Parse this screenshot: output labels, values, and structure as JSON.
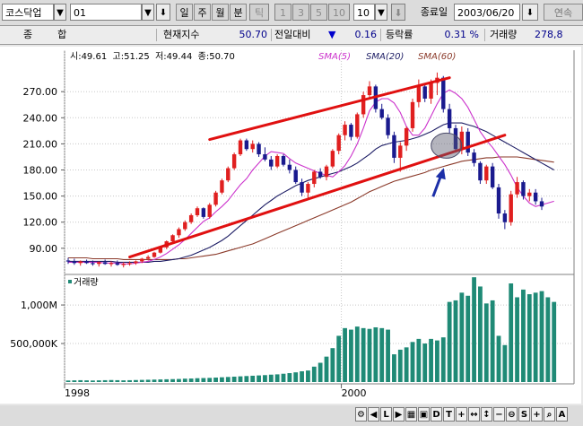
{
  "toolbar": {
    "market": "코스닥업",
    "code": "01",
    "period_buttons": [
      "일",
      "주",
      "월",
      "분",
      "틱"
    ],
    "interval_buttons": [
      "1",
      "3",
      "5",
      "10"
    ],
    "interval_value": "10",
    "end_date_label": "종료일",
    "end_date": "2003/06/20",
    "continuous_label": "연속"
  },
  "infobar": {
    "name": "종        합",
    "current_label": "현재지수",
    "current_value": "50.70",
    "change_label": "전일대비",
    "change_symbol": "▼",
    "change_value": "0.16",
    "rate_label": "등락률",
    "rate_value": "0.31 %",
    "volume_label": "거래량",
    "volume_value": "278,8"
  },
  "price_legend": {
    "ohlc": "시:49.61  고:51.25  저:49.44  종:50.70",
    "sma5": "SMA(5)",
    "sma20": "SMA(20)",
    "sma60": "SMA(60)"
  },
  "volume_legend": "거래량",
  "colors": {
    "up": "#e01f1f",
    "down": "#1a1a8e",
    "sma5": "#cc33cc",
    "sma20": "#1c1c64",
    "sma60": "#8b3a2a",
    "trendline": "#e01010",
    "volume": "#1f8a76"
  },
  "chart_data": [
    {
      "type": "candlestick",
      "title": "",
      "y_ticks": [
        "270.00",
        "240.00",
        "210.00",
        "180.00",
        "150.00",
        "120.00",
        "90.00"
      ],
      "ylim": [
        62,
        297
      ],
      "x_ticks": [
        "1998",
        "2000"
      ],
      "candles": [
        {
          "o": 76,
          "h": 79,
          "l": 72,
          "c": 75
        },
        {
          "o": 75,
          "h": 78,
          "l": 71,
          "c": 73
        },
        {
          "o": 73,
          "h": 76,
          "l": 70,
          "c": 75
        },
        {
          "o": 75,
          "h": 77,
          "l": 72,
          "c": 73
        },
        {
          "o": 73,
          "h": 76,
          "l": 70,
          "c": 72
        },
        {
          "o": 72,
          "h": 75,
          "l": 69,
          "c": 74
        },
        {
          "o": 74,
          "h": 77,
          "l": 71,
          "c": 72
        },
        {
          "o": 72,
          "h": 75,
          "l": 69,
          "c": 73
        },
        {
          "o": 73,
          "h": 76,
          "l": 70,
          "c": 71
        },
        {
          "o": 71,
          "h": 74,
          "l": 68,
          "c": 72
        },
        {
          "o": 72,
          "h": 75,
          "l": 70,
          "c": 73
        },
        {
          "o": 73,
          "h": 76,
          "l": 71,
          "c": 75
        },
        {
          "o": 75,
          "h": 79,
          "l": 73,
          "c": 78
        },
        {
          "o": 78,
          "h": 82,
          "l": 76,
          "c": 80
        },
        {
          "o": 80,
          "h": 86,
          "l": 79,
          "c": 85
        },
        {
          "o": 85,
          "h": 92,
          "l": 84,
          "c": 91
        },
        {
          "o": 91,
          "h": 99,
          "l": 89,
          "c": 98
        },
        {
          "o": 98,
          "h": 106,
          "l": 96,
          "c": 105
        },
        {
          "o": 105,
          "h": 114,
          "l": 102,
          "c": 112
        },
        {
          "o": 112,
          "h": 122,
          "l": 110,
          "c": 120
        },
        {
          "o": 120,
          "h": 130,
          "l": 118,
          "c": 128
        },
        {
          "o": 128,
          "h": 138,
          "l": 126,
          "c": 136
        },
        {
          "o": 136,
          "h": 137,
          "l": 124,
          "c": 126
        },
        {
          "o": 126,
          "h": 142,
          "l": 124,
          "c": 140
        },
        {
          "o": 140,
          "h": 156,
          "l": 138,
          "c": 154
        },
        {
          "o": 154,
          "h": 170,
          "l": 152,
          "c": 168
        },
        {
          "o": 168,
          "h": 184,
          "l": 166,
          "c": 182
        },
        {
          "o": 182,
          "h": 200,
          "l": 180,
          "c": 198
        },
        {
          "o": 198,
          "h": 216,
          "l": 196,
          "c": 214
        },
        {
          "o": 214,
          "h": 216,
          "l": 202,
          "c": 204
        },
        {
          "o": 204,
          "h": 214,
          "l": 200,
          "c": 210
        },
        {
          "o": 210,
          "h": 212,
          "l": 195,
          "c": 198
        },
        {
          "o": 198,
          "h": 206,
          "l": 190,
          "c": 192
        },
        {
          "o": 192,
          "h": 196,
          "l": 180,
          "c": 184
        },
        {
          "o": 184,
          "h": 198,
          "l": 182,
          "c": 196
        },
        {
          "o": 196,
          "h": 198,
          "l": 184,
          "c": 186
        },
        {
          "o": 186,
          "h": 192,
          "l": 176,
          "c": 180
        },
        {
          "o": 180,
          "h": 184,
          "l": 164,
          "c": 166
        },
        {
          "o": 166,
          "h": 170,
          "l": 150,
          "c": 154
        },
        {
          "o": 154,
          "h": 166,
          "l": 148,
          "c": 164
        },
        {
          "o": 164,
          "h": 180,
          "l": 160,
          "c": 178
        },
        {
          "o": 178,
          "h": 182,
          "l": 170,
          "c": 172
        },
        {
          "o": 172,
          "h": 186,
          "l": 168,
          "c": 184
        },
        {
          "o": 184,
          "h": 204,
          "l": 182,
          "c": 202
        },
        {
          "o": 202,
          "h": 222,
          "l": 198,
          "c": 220
        },
        {
          "o": 220,
          "h": 236,
          "l": 214,
          "c": 232
        },
        {
          "o": 232,
          "h": 234,
          "l": 214,
          "c": 218
        },
        {
          "o": 218,
          "h": 246,
          "l": 216,
          "c": 244
        },
        {
          "o": 244,
          "h": 270,
          "l": 240,
          "c": 266
        },
        {
          "o": 266,
          "h": 282,
          "l": 262,
          "c": 276
        },
        {
          "o": 276,
          "h": 278,
          "l": 246,
          "c": 250
        },
        {
          "o": 250,
          "h": 256,
          "l": 238,
          "c": 240
        },
        {
          "o": 240,
          "h": 244,
          "l": 216,
          "c": 220
        },
        {
          "o": 220,
          "h": 224,
          "l": 188,
          "c": 194
        },
        {
          "o": 194,
          "h": 212,
          "l": 178,
          "c": 208
        },
        {
          "o": 208,
          "h": 230,
          "l": 202,
          "c": 228
        },
        {
          "o": 228,
          "h": 262,
          "l": 224,
          "c": 258
        },
        {
          "o": 258,
          "h": 284,
          "l": 252,
          "c": 276
        },
        {
          "o": 276,
          "h": 280,
          "l": 258,
          "c": 262
        },
        {
          "o": 262,
          "h": 284,
          "l": 256,
          "c": 280
        },
        {
          "o": 280,
          "h": 292,
          "l": 266,
          "c": 286
        },
        {
          "o": 286,
          "h": 288,
          "l": 246,
          "c": 250
        },
        {
          "o": 250,
          "h": 256,
          "l": 222,
          "c": 228
        },
        {
          "o": 228,
          "h": 232,
          "l": 200,
          "c": 204
        },
        {
          "o": 204,
          "h": 230,
          "l": 198,
          "c": 224
        },
        {
          "o": 224,
          "h": 228,
          "l": 196,
          "c": 200
        },
        {
          "o": 200,
          "h": 204,
          "l": 184,
          "c": 188
        },
        {
          "o": 188,
          "h": 190,
          "l": 164,
          "c": 168
        },
        {
          "o": 168,
          "h": 186,
          "l": 164,
          "c": 184
        },
        {
          "o": 184,
          "h": 188,
          "l": 158,
          "c": 160
        },
        {
          "o": 160,
          "h": 164,
          "l": 124,
          "c": 130
        },
        {
          "o": 130,
          "h": 134,
          "l": 112,
          "c": 120
        },
        {
          "o": 120,
          "h": 156,
          "l": 116,
          "c": 152
        },
        {
          "o": 152,
          "h": 172,
          "l": 148,
          "c": 166
        },
        {
          "o": 166,
          "h": 168,
          "l": 146,
          "c": 150
        },
        {
          "o": 150,
          "h": 158,
          "l": 144,
          "c": 154
        },
        {
          "o": 154,
          "h": 158,
          "l": 140,
          "c": 144
        },
        {
          "o": 144,
          "h": 148,
          "l": 134,
          "c": 138
        }
      ],
      "sma5": [
        74,
        74,
        74,
        74,
        74,
        74,
        73,
        73,
        73,
        72,
        72,
        73,
        74,
        75,
        77,
        80,
        84,
        89,
        94,
        100,
        107,
        114,
        121,
        125,
        132,
        138,
        145,
        154,
        163,
        170,
        180,
        188,
        196,
        201,
        200,
        199,
        193,
        188,
        185,
        182,
        179,
        176,
        174,
        172,
        178,
        185,
        196,
        210,
        228,
        248,
        258,
        262,
        262,
        257,
        246,
        230,
        220,
        220,
        228,
        242,
        256,
        268,
        272,
        268,
        262,
        252,
        238,
        224,
        214,
        206,
        196,
        186,
        174,
        160,
        150,
        142,
        138,
        140,
        142,
        144
      ],
      "sma20": [
        75,
        75,
        75,
        75,
        75,
        75,
        75,
        75,
        74,
        74,
        74,
        74,
        74,
        74,
        75,
        75,
        76,
        77,
        78,
        80,
        82,
        85,
        88,
        91,
        95,
        99,
        104,
        110,
        116,
        122,
        128,
        134,
        140,
        145,
        150,
        154,
        158,
        162,
        165,
        168,
        170,
        172,
        174,
        176,
        178,
        181,
        184,
        188,
        193,
        198,
        204,
        208,
        210,
        212,
        213,
        214,
        216,
        218,
        221,
        224,
        228,
        232,
        234,
        234,
        234,
        232,
        230,
        227,
        224,
        220,
        216,
        212,
        208,
        204,
        200,
        196,
        192,
        188,
        184,
        180
      ],
      "sma60": [
        79,
        79,
        79,
        79,
        78,
        78,
        78,
        78,
        78,
        77,
        77,
        77,
        77,
        77,
        77,
        77,
        77,
        77,
        78,
        78,
        79,
        80,
        81,
        82,
        83,
        85,
        87,
        89,
        91,
        93,
        95,
        98,
        101,
        104,
        107,
        110,
        113,
        116,
        119,
        122,
        125,
        128,
        131,
        134,
        137,
        140,
        143,
        147,
        151,
        155,
        158,
        161,
        164,
        167,
        169,
        171,
        173,
        175,
        177,
        180,
        182,
        184,
        186,
        188,
        190,
        191,
        192,
        193,
        194,
        194,
        195,
        195,
        195,
        195,
        194,
        193,
        192,
        191,
        190,
        189
      ],
      "annotations": {
        "upper_trendline": [
          [
            23,
            215
          ],
          [
            62,
            286
          ]
        ],
        "lower_trendline": [
          [
            10,
            80
          ],
          [
            71,
            220
          ]
        ]
      }
    },
    {
      "type": "bar",
      "title": "",
      "y_ticks": [
        "1,000M",
        "500,000K"
      ],
      "ylim": [
        0,
        1350
      ],
      "volume": [
        20,
        22,
        24,
        22,
        20,
        22,
        24,
        26,
        24,
        22,
        24,
        26,
        28,
        30,
        32,
        34,
        36,
        38,
        40,
        44,
        46,
        50,
        52,
        54,
        58,
        62,
        66,
        70,
        74,
        78,
        82,
        86,
        90,
        96,
        100,
        108,
        116,
        126,
        140,
        150,
        200,
        250,
        330,
        440,
        600,
        700,
        680,
        720,
        700,
        690,
        710,
        700,
        680,
        360,
        420,
        450,
        520,
        560,
        500,
        560,
        540,
        580,
        1040,
        1060,
        1160,
        1120,
        1360,
        1240,
        1020,
        1060,
        600,
        480,
        1280,
        1100,
        1200,
        1140,
        1160,
        1180,
        1100,
        1040
      ]
    }
  ]
}
